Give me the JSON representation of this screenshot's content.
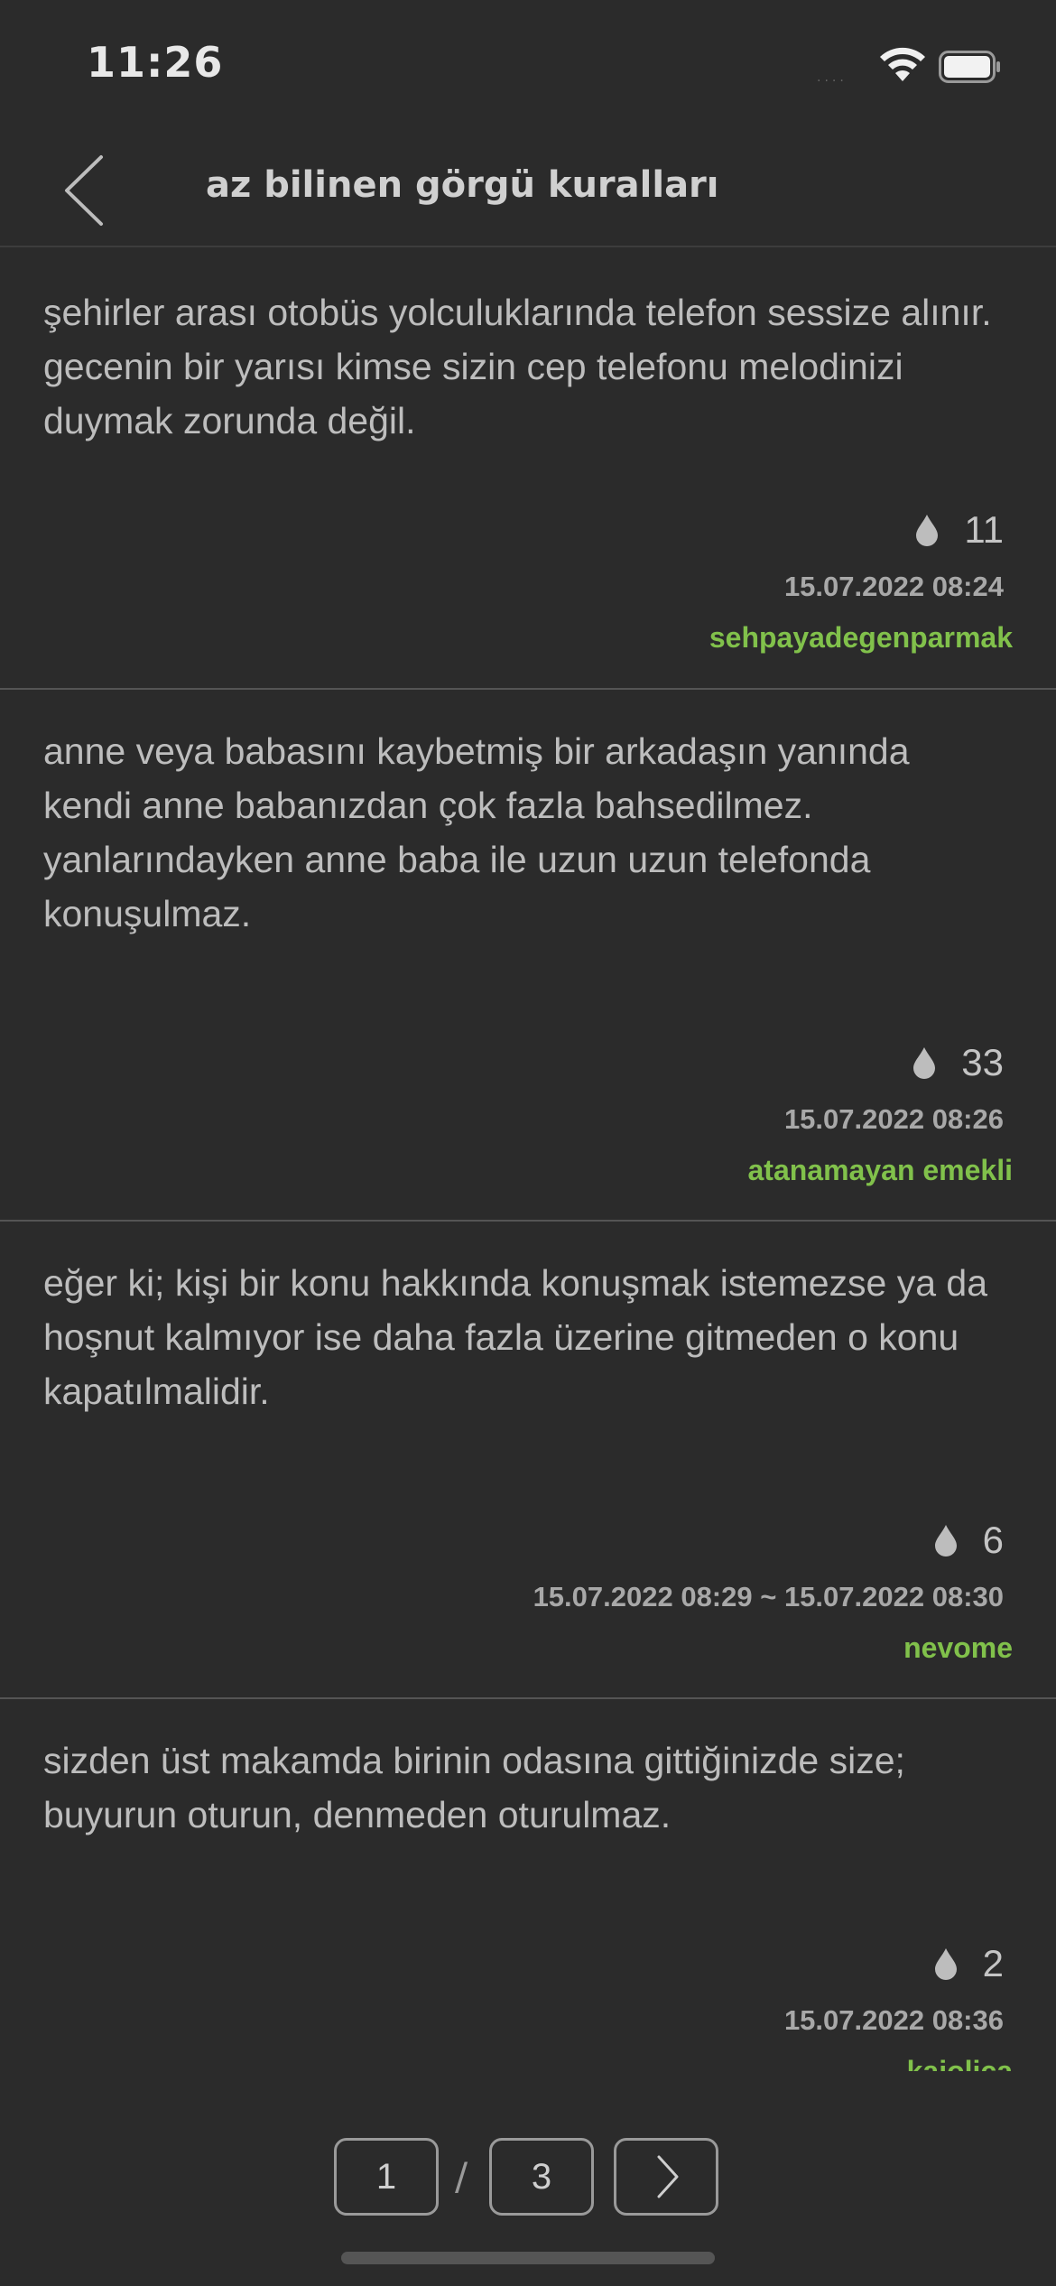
{
  "status_bar": {
    "time": "11:26",
    "signal": "····"
  },
  "nav": {
    "title": "az bilinen görgü kuralları"
  },
  "entries": [
    {
      "text": "şehirler arası otobüs yolculuklarında telefon sessize alınır. gecenin bir yarısı kimse sizin cep telefonu melodinizi duymak zorunda değil.",
      "favorites": "11",
      "date": "15.07.2022 08:24",
      "author": "sehpayadegenparmak"
    },
    {
      "text": "anne veya babasını kaybetmiş bir arkadaşın yanında kendi anne babanızdan çok fazla bahsedilmez. yanlarındayken anne baba ile uzun uzun telefonda konuşulmaz.",
      "favorites": "33",
      "date": "15.07.2022 08:26",
      "author": "atanamayan emekli"
    },
    {
      "text": "eğer ki; kişi bir konu hakkında konuşmak istemezse ya da hoşnut kalmıyor ise daha fazla üzerine gitmeden o konu kapatılmalidir.",
      "favorites": "6",
      "date": "15.07.2022 08:29 ~ 15.07.2022 08:30",
      "author": "nevome"
    },
    {
      "text": "sizden üst makamda birinin odasına gittiğinizde size; buyurun oturun, denmeden oturulmaz.",
      "favorites": "2",
      "date": "15.07.2022 08:36",
      "author": "kajolica"
    }
  ],
  "pager": {
    "current": "1",
    "separator": "/",
    "total": "3"
  },
  "colors": {
    "background": "#2b2b2b",
    "author": "#81c14b",
    "text": "#bdbdbd"
  }
}
